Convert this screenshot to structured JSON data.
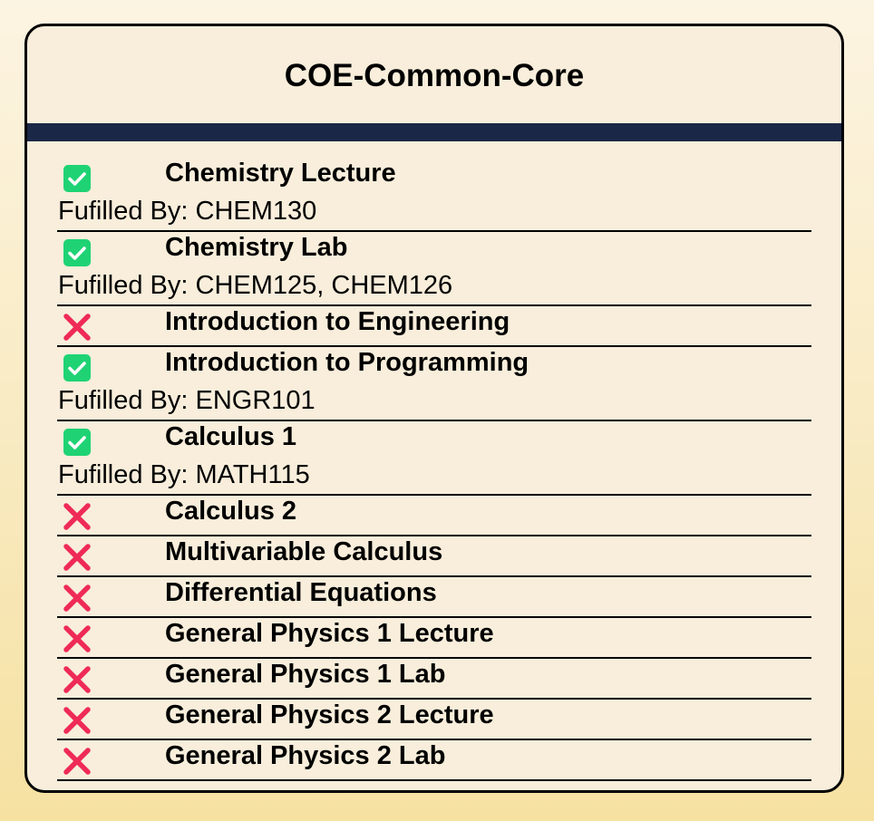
{
  "card": {
    "title": "COE-Common-Core"
  },
  "colors": {
    "header_bar": "#1b2747",
    "check_green": "#1fd374",
    "cross_red": "#ef2a57"
  },
  "fulfilled_prefix": "Fufilled By: ",
  "requirements": [
    {
      "name": "Chemistry Lecture",
      "status": "check-icon",
      "fulfilled_by": "Fufilled By: CHEM130"
    },
    {
      "name": "Chemistry Lab",
      "status": "check-icon",
      "fulfilled_by": "Fufilled By: CHEM125, CHEM126"
    },
    {
      "name": "Introduction to Engineering",
      "status": "cross-icon",
      "fulfilled_by": ""
    },
    {
      "name": "Introduction to Programming",
      "status": "check-icon",
      "fulfilled_by": "Fufilled By: ENGR101"
    },
    {
      "name": "Calculus 1",
      "status": "check-icon",
      "fulfilled_by": "Fufilled By: MATH115"
    },
    {
      "name": "Calculus 2",
      "status": "cross-icon",
      "fulfilled_by": ""
    },
    {
      "name": "Multivariable Calculus",
      "status": "cross-icon",
      "fulfilled_by": ""
    },
    {
      "name": "Differential Equations",
      "status": "cross-icon",
      "fulfilled_by": ""
    },
    {
      "name": "General Physics 1 Lecture",
      "status": "cross-icon",
      "fulfilled_by": ""
    },
    {
      "name": "General Physics 1 Lab",
      "status": "cross-icon",
      "fulfilled_by": ""
    },
    {
      "name": "General Physics 2 Lecture",
      "status": "cross-icon",
      "fulfilled_by": ""
    },
    {
      "name": "General Physics 2 Lab",
      "status": "cross-icon",
      "fulfilled_by": ""
    }
  ]
}
